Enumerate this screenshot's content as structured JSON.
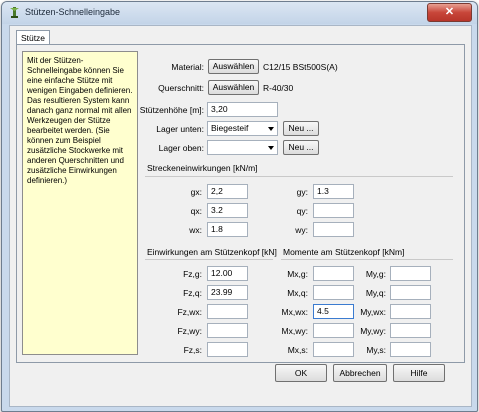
{
  "window": {
    "title": "Stützen-Schnelleingabe",
    "close_glyph": "✕"
  },
  "tab": {
    "label": "Stütze"
  },
  "info_text": "Mit der Stützen-Schnelleingabe können Sie eine einfache Stütze mit wenigen Eingaben definieren. Das resultieren System kann danach ganz normal mit allen Werkzeugen der Stütze bearbeitet werden. (Sie können zum Beispiel zusätzliche Stockwerke mit anderen Querschnitten und zusätzliche Einwirkungen definieren.)",
  "material": {
    "label": "Material:",
    "button": "Auswählen",
    "value": "C12/15 BSt500S(A)"
  },
  "querschnitt": {
    "label": "Querschnitt:",
    "button": "Auswählen",
    "value": "R-40/30"
  },
  "hoehe": {
    "label": "Stützenhöhe [m]:",
    "value": "3,20"
  },
  "lager_unten": {
    "label": "Lager unten:",
    "value": "Biegesteif",
    "new_button": "Neu ..."
  },
  "lager_oben": {
    "label": "Lager oben:",
    "value": "",
    "new_button": "Neu ..."
  },
  "strecken": {
    "title": "Streckeneinwirkungen [kN/m]",
    "gx": {
      "label": "gx:",
      "value": "2,2"
    },
    "gy": {
      "label": "gy:",
      "value": "1.3"
    },
    "qx": {
      "label": "qx:",
      "value": "3.2"
    },
    "qy": {
      "label": "qy:",
      "value": ""
    },
    "wx": {
      "label": "wx:",
      "value": "1.8"
    },
    "wy": {
      "label": "wy:",
      "value": ""
    }
  },
  "kopf": {
    "title": "Einwirkungen am Stützenkopf [kN]",
    "rows": [
      {
        "label": "Fz,g:",
        "value": "12.00"
      },
      {
        "label": "Fz,q:",
        "value": "23.99"
      },
      {
        "label": "Fz,wx:",
        "value": ""
      },
      {
        "label": "Fz,wy:",
        "value": ""
      },
      {
        "label": "Fz,s:",
        "value": ""
      }
    ]
  },
  "momente": {
    "title": "Momente am Stützenkopf [kNm]",
    "mx": [
      {
        "label": "Mx,g:",
        "value": ""
      },
      {
        "label": "Mx,q:",
        "value": ""
      },
      {
        "label": "Mx,wx:",
        "value": "4.5"
      },
      {
        "label": "Mx,wy:",
        "value": ""
      },
      {
        "label": "Mx,s:",
        "value": ""
      }
    ],
    "my": [
      {
        "label": "My,g:",
        "value": ""
      },
      {
        "label": "My,q:",
        "value": ""
      },
      {
        "label": "My,wx:",
        "value": ""
      },
      {
        "label": "My,wy:",
        "value": ""
      },
      {
        "label": "My,s:",
        "value": ""
      }
    ]
  },
  "footer": {
    "ok": "OK",
    "cancel": "Abbrechen",
    "help": "Hilfe"
  }
}
